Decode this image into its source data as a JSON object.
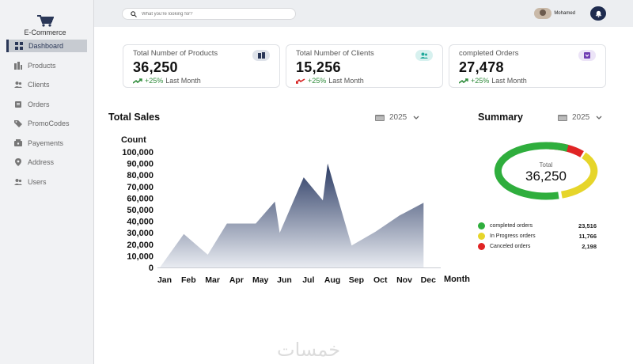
{
  "app": {
    "logo_text": "E-Commerce"
  },
  "sidebar": {
    "items": [
      {
        "label": "Dashboard",
        "icon": "grid-icon",
        "active": true
      },
      {
        "label": "Products",
        "icon": "products-icon"
      },
      {
        "label": "Clients",
        "icon": "users-icon"
      },
      {
        "label": "Orders",
        "icon": "orders-icon"
      },
      {
        "label": "PromoCodes",
        "icon": "tag-icon"
      },
      {
        "label": "Payements",
        "icon": "wallet-icon"
      },
      {
        "label": "Address",
        "icon": "location-icon"
      },
      {
        "label": "Users",
        "icon": "users-icon"
      }
    ]
  },
  "topbar": {
    "search_placeholder": "What you're looking for?",
    "user_name": "Mohamed"
  },
  "cards": [
    {
      "title": "Total Number of Products",
      "value": "36,250",
      "change": "+25%",
      "period": "Last Month",
      "trend": "up",
      "icon": "products-icon",
      "icon_bg": "#dfe3ea",
      "icon_color": "#2a3757"
    },
    {
      "title": "Total Number of Clients",
      "value": "15,256",
      "change": "+25%",
      "period": "Last Month",
      "trend": "down",
      "icon": "users-icon",
      "icon_bg": "#d7f1ef",
      "icon_color": "#20a99b"
    },
    {
      "title": "completed Orders",
      "value": "27,478",
      "change": "+25%",
      "period": "Last Month",
      "trend": "up",
      "icon": "orders-icon",
      "icon_bg": "#ece4f7",
      "icon_color": "#6f3cb3"
    }
  ],
  "sales": {
    "title": "Total Sales",
    "year": "2025"
  },
  "summary": {
    "title": "Summary",
    "year": "2025",
    "total_label": "Total",
    "total_value": "36,250",
    "legend": [
      {
        "label": "completed orders",
        "value": "23,516",
        "color": "#2fae3d"
      },
      {
        "label": "In Progress orders",
        "value": "11,766",
        "color": "#e6d52a"
      },
      {
        "label": "Canceled orders",
        "value": "2,198",
        "color": "#e02424"
      }
    ]
  },
  "chart_data": [
    {
      "type": "area",
      "title": "",
      "ylabel": "Count",
      "xlabel": "Month",
      "categories": [
        "Jan",
        "Feb",
        "Mar",
        "Apr",
        "May",
        "Jun",
        "Jul",
        "Aug",
        "Sep",
        "Oct",
        "Nov",
        "Dec"
      ],
      "x": [
        0,
        1,
        2,
        2.8,
        3,
        4,
        4.8,
        5,
        6,
        6.8,
        7,
        8,
        9,
        10,
        11
      ],
      "values": [
        0,
        29000,
        11000,
        38000,
        38000,
        38000,
        57000,
        30000,
        78000,
        58000,
        90000,
        19000,
        31000,
        45000,
        56000
      ],
      "yticks": [
        0,
        10000,
        20000,
        30000,
        40000,
        50000,
        60000,
        70000,
        80000,
        90000,
        100000
      ],
      "ytick_labels": [
        "0",
        "10,000",
        "20,000",
        "30,000",
        "40,000",
        "50,000",
        "60,000",
        "70,000",
        "80,000",
        "90,000",
        "100,000"
      ],
      "ylim": [
        0,
        100000
      ],
      "grid": false,
      "color_top": "#2a3a63",
      "color_bottom": "#e8ebf1"
    },
    {
      "type": "pie",
      "title": "Summary",
      "categories": [
        "completed orders",
        "In Progress orders",
        "Canceled orders"
      ],
      "values": [
        23516,
        11766,
        2198
      ],
      "colors": [
        "#2fae3d",
        "#e6d52a",
        "#e02424"
      ]
    }
  ],
  "watermark": "خمسات"
}
